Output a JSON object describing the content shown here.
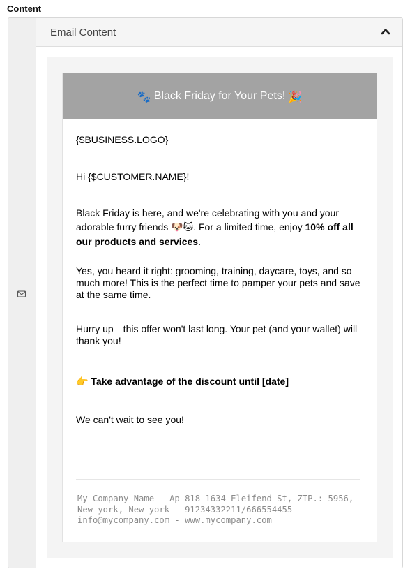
{
  "section": {
    "label": "Content"
  },
  "panel": {
    "title": "Email Content",
    "collapse_icon": "chevron-up-icon",
    "rail_icon": "envelope-icon"
  },
  "email": {
    "banner": {
      "prefix_emoji": "🐾",
      "text": "Black Friday for Your Pets!",
      "suffix_emoji": "🎉"
    },
    "logo_placeholder": "{$BUSINESS.LOGO}",
    "greeting": "Hi {$CUSTOMER.NAME}!",
    "intro_start": "Black Friday is here, and we're celebrating with you and your adorable furry friends",
    "intro_emoji": "🐶🐱",
    "intro_mid": ". For a limited time, enjoy ",
    "intro_bold": "10% off all our products and services",
    "intro_end": ".",
    "services_text": "Yes, you heard it right: grooming, training, daycare, toys, and so much more! This is the perfect time to pamper your pets and save at the same time.",
    "hurry_text": "Hurry up—this offer won't last long. Your pet (and your wallet) will thank you!",
    "cta_emoji": "👉",
    "cta_text": "Take advantage of the discount until [date]",
    "closing": "We can't wait to see you!",
    "footer": "My Company Name - Ap 818-1634 Eleifend St, ZIP.: 5956, New york, New york - 91234332211/666554455 - info@mycompany.com - www.mycompany.com"
  },
  "colors": {
    "banner_bg": "#a3a3a3",
    "panel_header_bg": "#f5f5f5",
    "rail_bg": "#efefef",
    "footer_text": "#8a8a8a"
  }
}
